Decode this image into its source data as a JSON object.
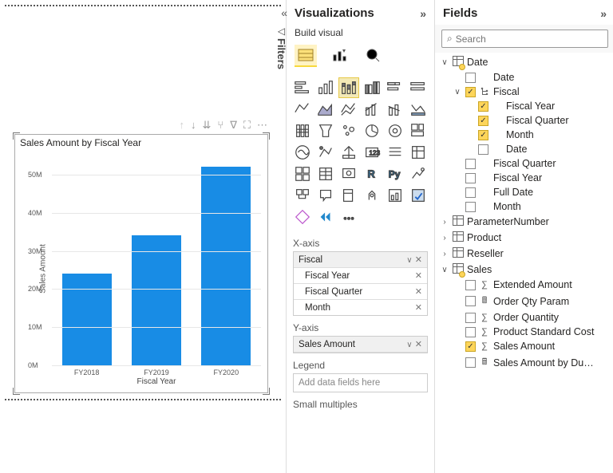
{
  "chart_data": {
    "type": "bar",
    "title": "Sales Amount by Fiscal Year",
    "xlabel": "Fiscal Year",
    "ylabel": "Sales Amount",
    "ylim": [
      0,
      55000000
    ],
    "y_ticks": [
      "0M",
      "10M",
      "20M",
      "30M",
      "40M",
      "50M"
    ],
    "categories": [
      "FY2018",
      "FY2019",
      "FY2020"
    ],
    "values": [
      24000000,
      34000000,
      52000000
    ]
  },
  "filters_label": "Filters",
  "vis_pane": {
    "title": "Visualizations",
    "subtitle": "Build visual",
    "wells": {
      "xaxis": {
        "label": "X-axis",
        "group": "Fiscal",
        "items": [
          "Fiscal Year",
          "Fiscal Quarter",
          "Month"
        ]
      },
      "yaxis": {
        "label": "Y-axis",
        "items": [
          "Sales Amount"
        ]
      },
      "legend": {
        "label": "Legend",
        "placeholder": "Add data fields here"
      },
      "small_multiples": {
        "label": "Small multiples"
      }
    }
  },
  "fields_pane": {
    "title": "Fields",
    "search_placeholder": "Search",
    "tree": {
      "date": {
        "label": "Date",
        "children": {
          "date1": "Date",
          "fiscal": {
            "label": "Fiscal",
            "children": {
              "fy": "Fiscal Year",
              "fq": "Fiscal Quarter",
              "mo": "Month",
              "dt": "Date"
            }
          },
          "fq2": "Fiscal Quarter",
          "fy2": "Fiscal Year",
          "full": "Full Date",
          "mo2": "Month"
        }
      },
      "param": "ParameterNumber",
      "product": "Product",
      "reseller": "Reseller",
      "sales": {
        "label": "Sales",
        "children": {
          "ext": "Extended Amount",
          "oqp": "Order Qty Param",
          "oq": "Order Quantity",
          "psc": "Product Standard Cost",
          "sa": "Sales Amount",
          "sadu": "Sales Amount by Du…"
        }
      }
    }
  }
}
